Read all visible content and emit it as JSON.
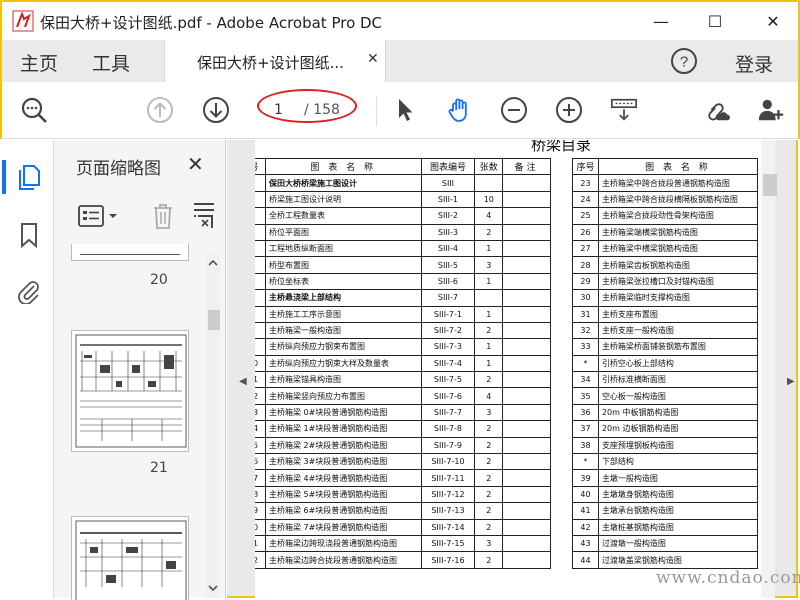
{
  "window": {
    "title": "保田大桥+设计图纸.pdf - Adobe Acrobat Pro DC",
    "controls": {
      "minimize": "—",
      "maximize": "☐",
      "close": "✕"
    }
  },
  "tabs": {
    "home": "主页",
    "tools": "工具",
    "document": "保田大桥+设计图纸...",
    "help": "?",
    "login": "登录"
  },
  "toolbar": {
    "current_page": "1",
    "total_pages": "/ 158"
  },
  "panel": {
    "title": "页面缩略图",
    "close": "✕",
    "thumbnails": [
      "20",
      "21"
    ]
  },
  "document": {
    "heading": "桥梁目录",
    "left_headers": [
      "号",
      "图 表 名 称",
      "图表编号",
      "张数",
      "备注"
    ],
    "right_headers": [
      "序号",
      "图 表 名 称"
    ],
    "left_rows": [
      [
        "",
        "保田大桥桥梁施工图设计",
        "SIII",
        "",
        ""
      ],
      [
        "",
        "桥梁施工图设计说明",
        "SIII-1",
        "10",
        ""
      ],
      [
        "",
        "全桥工程数量表",
        "SIII-2",
        "4",
        ""
      ],
      [
        "",
        "桥位平面图",
        "SIII-3",
        "2",
        ""
      ],
      [
        "",
        "工程地质纵断面图",
        "SIII-4",
        "1",
        ""
      ],
      [
        "",
        "桥型布置图",
        "SIII-5",
        "3",
        ""
      ],
      [
        "",
        "桥位坐标表",
        "SIII-6",
        "1",
        ""
      ],
      [
        "",
        "主桥悬浇梁上部结构",
        "SIII-7",
        "",
        ""
      ],
      [
        "",
        "主桥施工工序示意图",
        "SIII-7-1",
        "1",
        ""
      ],
      [
        "",
        "主桥箱梁一般构造图",
        "SIII-7-2",
        "2",
        ""
      ],
      [
        "",
        "主桥纵向预应力钢束布置图",
        "SIII-7-3",
        "1",
        ""
      ],
      [
        "0",
        "主桥纵向预应力钢束大样及数量表",
        "SIII-7-4",
        "1",
        ""
      ],
      [
        "1",
        "主桥箱梁锚具构造图",
        "SIII-7-5",
        "2",
        ""
      ],
      [
        "2",
        "主桥箱梁竖向预应力布置图",
        "SIII-7-6",
        "4",
        ""
      ],
      [
        "3",
        "主桥箱梁 0#块段普通钢筋构造图",
        "SIII-7-7",
        "3",
        ""
      ],
      [
        "4",
        "主桥箱梁 1#块段普通钢筋构造图",
        "SIII-7-8",
        "2",
        ""
      ],
      [
        "5",
        "主桥箱梁 2#块段普通钢筋构造图",
        "SIII-7-9",
        "2",
        ""
      ],
      [
        "6",
        "主桥箱梁 3#块段普通钢筋构造图",
        "SIII-7-10",
        "2",
        ""
      ],
      [
        "7",
        "主桥箱梁 4#块段普通钢筋构造图",
        "SIII-7-11",
        "2",
        ""
      ],
      [
        "8",
        "主桥箱梁 5#块段普通钢筋构造图",
        "SIII-7-12",
        "2",
        ""
      ],
      [
        "9",
        "主桥箱梁 6#块段普通钢筋构造图",
        "SIII-7-13",
        "2",
        ""
      ],
      [
        "0",
        "主桥箱梁 7#块段普通钢筋构造图",
        "SIII-7-14",
        "2",
        ""
      ],
      [
        "1",
        "主桥箱梁边跨现浇段普通钢筋构造图",
        "SIII-7-15",
        "3",
        ""
      ],
      [
        "2",
        "主桥箱梁边跨合拢段普通钢筋构造图",
        "SIII-7-16",
        "2",
        ""
      ]
    ],
    "right_rows": [
      [
        "23",
        "主桥箱梁中跨合拢段普通钢筋构造图"
      ],
      [
        "24",
        "主桥箱梁中跨合拢段横隔板钢筋构造图"
      ],
      [
        "25",
        "主桥箱梁合拢段劲性骨架构造图"
      ],
      [
        "26",
        "主桥箱梁端横梁钢筋构造图"
      ],
      [
        "27",
        "主桥箱梁中横梁钢筋构造图"
      ],
      [
        "28",
        "主桥箱梁齿板钢筋构造图"
      ],
      [
        "29",
        "主桥箱梁张拉槽口及封锚构造图"
      ],
      [
        "30",
        "主桥箱梁临时支撑构造图"
      ],
      [
        "31",
        "主桥支座布置图"
      ],
      [
        "32",
        "主桥支座一般构造图"
      ],
      [
        "33",
        "主桥箱梁桥面铺装钢筋布置图"
      ],
      [
        "*",
        "引桥空心板上部结构"
      ],
      [
        "34",
        "引桥标准横断面图"
      ],
      [
        "35",
        "空心板一般构造图"
      ],
      [
        "36",
        "20m 中板钢筋构造图"
      ],
      [
        "37",
        "20m 边板钢筋构造图"
      ],
      [
        "38",
        "支座预埋钢板构造图"
      ],
      [
        "*",
        "下部结构"
      ],
      [
        "39",
        "主墩一般构造图"
      ],
      [
        "40",
        "主墩墩身钢筋构造图"
      ],
      [
        "41",
        "主墩承台钢筋构造图"
      ],
      [
        "42",
        "主墩桩基钢筋构造图"
      ],
      [
        "43",
        "过渡墩一般构造图"
      ],
      [
        "44",
        "过渡墩盖梁钢筋构造图"
      ]
    ]
  },
  "watermark": "www.cndao.com",
  "colors": {
    "accent": "#1473e6",
    "frame": "#f3c20c",
    "highlight": "#e02020"
  }
}
